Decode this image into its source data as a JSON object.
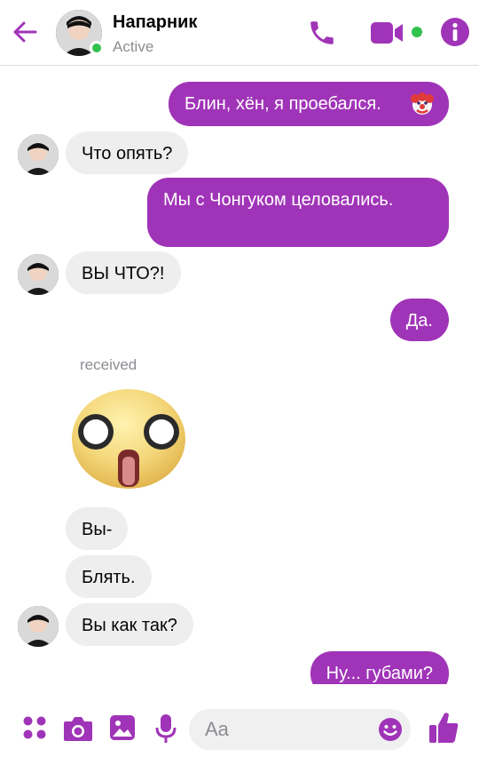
{
  "header": {
    "contact_name": "Напарник",
    "status": "Active"
  },
  "messages": [
    {
      "direction": "out",
      "text": "Блин, хён, я проебался."
    },
    {
      "direction": "in",
      "text": "Что опять?"
    },
    {
      "direction": "out",
      "text": "Мы с Чонгуком целовались."
    },
    {
      "direction": "in",
      "text": "ВЫ ЧТО?!"
    },
    {
      "direction": "out",
      "text": "Да."
    },
    {
      "direction": "in",
      "text": "Вы-"
    },
    {
      "direction": "in",
      "text": "Блять."
    },
    {
      "direction": "in",
      "text": "Вы как так?"
    },
    {
      "direction": "out",
      "text": "Ну... губами?"
    }
  ],
  "received_label": "received",
  "composer": {
    "placeholder": "Aa"
  },
  "colors": {
    "accent": "#a034b8",
    "incoming_bubble": "#eeeeee",
    "online": "#31c24d"
  }
}
